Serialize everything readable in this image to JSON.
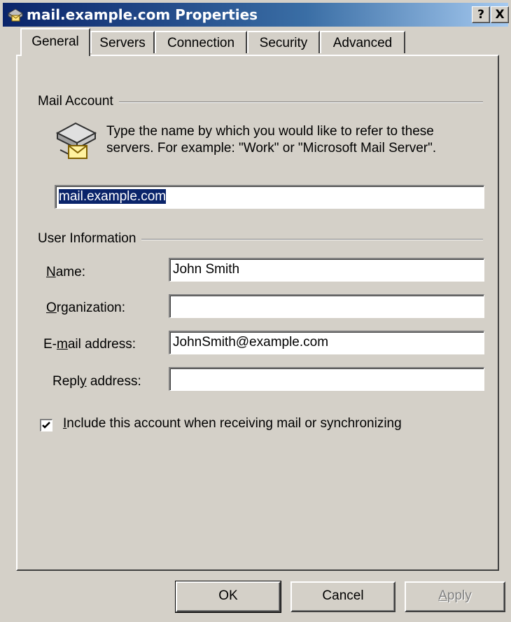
{
  "window": {
    "title": "mail.example.com Properties",
    "help_label": "?",
    "close_label": "X"
  },
  "tabs": [
    {
      "label": "General",
      "active": true
    },
    {
      "label": "Servers",
      "active": false
    },
    {
      "label": "Connection",
      "active": false
    },
    {
      "label": "Security",
      "active": false
    },
    {
      "label": "Advanced",
      "active": false
    }
  ],
  "mail_account": {
    "group_label": "Mail Account",
    "description": "Type the name by which you would like to refer to these servers.  For example: \"Work\" or \"Microsoft Mail Server\".",
    "account_name": "mail.example.com"
  },
  "user_info": {
    "group_label": "User Information",
    "name_label_prefix": "",
    "name_label_ul": "N",
    "name_label_rest": "ame:",
    "name_value": "John Smith",
    "org_label_ul": "O",
    "org_label_rest": "rganization:",
    "org_value": "",
    "email_label_prefix": "E-",
    "email_label_ul": "m",
    "email_label_rest": "ail address:",
    "email_value": "JohnSmith@example.com",
    "reply_label_prefix": "Repl",
    "reply_label_ul": "y",
    "reply_label_rest": " address:",
    "reply_value": ""
  },
  "include_checkbox": {
    "checked": true,
    "label_ul": "I",
    "label_rest": "nclude this account when receiving mail or synchronizing"
  },
  "buttons": {
    "ok": "OK",
    "cancel": "Cancel",
    "apply_ul": "A",
    "apply_rest": "pply"
  },
  "colors": {
    "titlebar_start": "#0a246a",
    "titlebar_end": "#a6caf0",
    "face": "#d4d0c8",
    "selection": "#0a246a"
  }
}
